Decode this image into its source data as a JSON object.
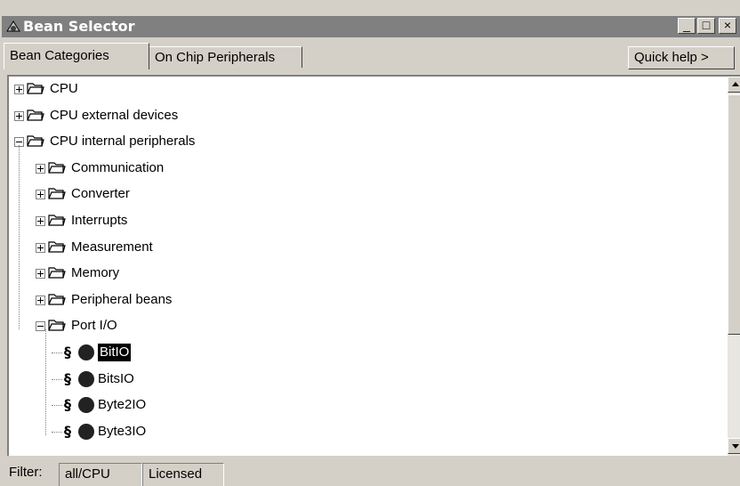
{
  "window": {
    "title": "Bean Selector",
    "minimize": "_",
    "maximize": "□",
    "close": "×"
  },
  "tabs": [
    {
      "label": "Bean Categories",
      "active": true
    },
    {
      "label": "On Chip Peripherals",
      "active": false
    }
  ],
  "quick_help": "Quick help >",
  "tree": [
    {
      "label": "CPU",
      "level": 0,
      "expanded": false
    },
    {
      "label": "CPU external devices",
      "level": 0,
      "expanded": false
    },
    {
      "label": "CPU internal peripherals",
      "level": 0,
      "expanded": true
    },
    {
      "label": "Communication",
      "level": 1,
      "expanded": false
    },
    {
      "label": "Converter",
      "level": 1,
      "expanded": false
    },
    {
      "label": "Interrupts",
      "level": 1,
      "expanded": false
    },
    {
      "label": "Measurement",
      "level": 1,
      "expanded": false
    },
    {
      "label": "Memory",
      "level": 1,
      "expanded": false
    },
    {
      "label": "Peripheral beans",
      "level": 1,
      "expanded": false
    },
    {
      "label": "Port I/O",
      "level": 1,
      "expanded": true
    },
    {
      "label": "BitIO",
      "level": 2,
      "bean": true,
      "selected": true,
      "prefix": "§"
    },
    {
      "label": "BitsIO",
      "level": 2,
      "bean": true,
      "prefix": "§"
    },
    {
      "label": "Byte2IO",
      "level": 2,
      "bean": true,
      "prefix": "§"
    },
    {
      "label": "Byte3IO",
      "level": 2,
      "bean": true,
      "prefix": "§"
    }
  ],
  "status": {
    "filter_label": "Filter:",
    "filter_value": "all/CPU",
    "license": "Licensed"
  },
  "colors": {
    "titlebar": "#808080",
    "selection": "#000000",
    "face": "#d4d0c8"
  }
}
